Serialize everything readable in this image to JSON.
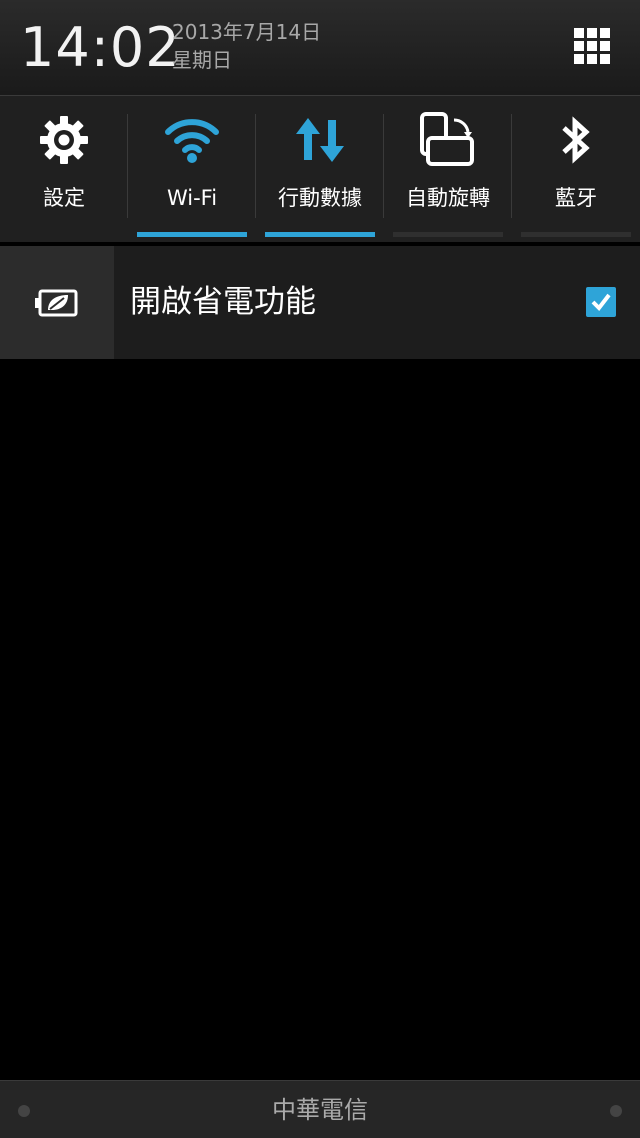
{
  "status_header": {
    "time": "14:02",
    "date": "2013年7月14日",
    "weekday": "星期日",
    "grid_icon": "app-grid-icon"
  },
  "quick_toggles": [
    {
      "label": "設定",
      "icon": "settings-gear-icon",
      "active": false,
      "has_indicator": false
    },
    {
      "label": "Wi-Fi",
      "icon": "wifi-icon",
      "active": true,
      "has_indicator": true
    },
    {
      "label": "行動數據",
      "icon": "mobile-data-icon",
      "active": true,
      "has_indicator": true
    },
    {
      "label": "自動旋轉",
      "icon": "auto-rotate-icon",
      "active": false,
      "has_indicator": true
    },
    {
      "label": "藍牙",
      "icon": "bluetooth-icon",
      "active": false,
      "has_indicator": true
    }
  ],
  "power_saver": {
    "label": "開啟省電功能",
    "checked": true,
    "icon": "battery-leaf-icon"
  },
  "footer": {
    "carrier": "中華電信"
  },
  "colors": {
    "accent": "#2ea4d8",
    "background": "#000000",
    "panel": "#202020"
  }
}
